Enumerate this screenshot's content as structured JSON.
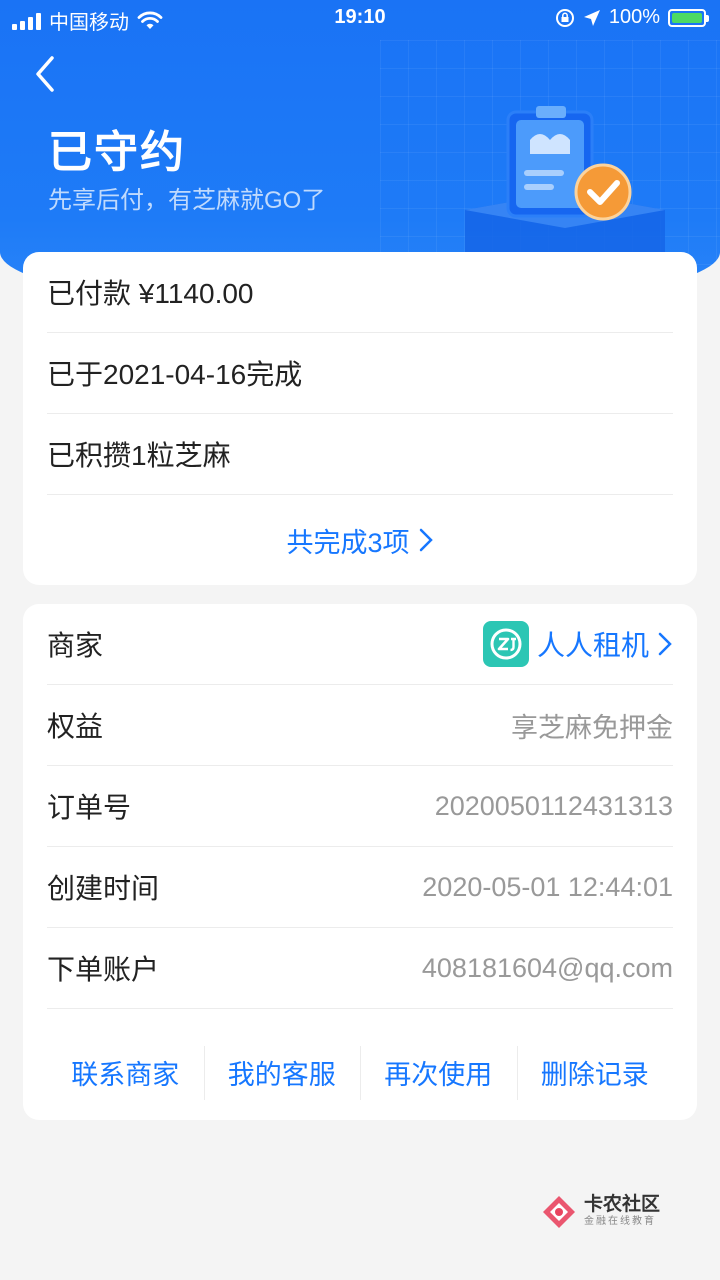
{
  "status_bar": {
    "carrier": "中国移动",
    "time": "19:10",
    "battery": "100%"
  },
  "header": {
    "title": "已守约",
    "subtitle": "先享后付，有芝麻就GO了"
  },
  "summary": {
    "paid": "已付款 ¥1140.00",
    "completed_on": "已于2021-04-16完成",
    "accumulated": "已积攒1粒芝麻",
    "total_link": "共完成3项"
  },
  "details": {
    "merchant_label": "商家",
    "merchant_name": "人人租机",
    "benefit_label": "权益",
    "benefit_value": "享芝麻免押金",
    "order_label": "订单号",
    "order_value": "2020050112431313",
    "created_label": "创建时间",
    "created_value": "2020-05-01 12:44:01",
    "account_label": "下单账户",
    "account_value": "408181604@qq.com"
  },
  "actions": {
    "contact": "联系商家",
    "service": "我的客服",
    "reuse": "再次使用",
    "delete": "删除记录"
  },
  "watermark": {
    "title": "卡农社区",
    "subtitle": "金融在线教育"
  },
  "colors": {
    "header_blue": "#1a73f5",
    "link_blue": "#1677ff",
    "check_orange": "#f59a37",
    "merchant_teal": "#2cc6b4"
  },
  "icons": [
    "back-arrow-icon",
    "wifi-icon",
    "lock-rotation-icon",
    "location-icon",
    "battery-icon",
    "chevron-right-icon",
    "check-icon",
    "merchant-logo-icon"
  ]
}
